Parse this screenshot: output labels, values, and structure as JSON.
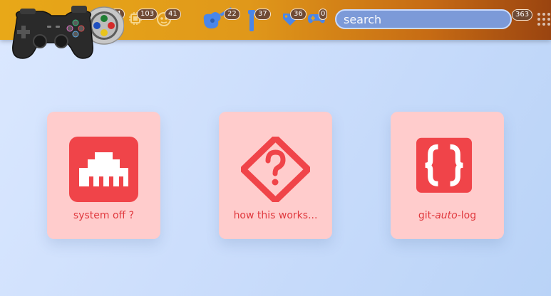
{
  "header": {
    "nav": [
      {
        "name": "nav-retro",
        "count": "64"
      },
      {
        "name": "nav-hardware",
        "count": "103"
      },
      {
        "name": "nav-lab",
        "count": "41"
      },
      {
        "name": "nav-guitar",
        "count": "22"
      },
      {
        "name": "nav-tools",
        "count": "37"
      },
      {
        "name": "nav-tags",
        "count": "36"
      },
      {
        "name": "nav-games",
        "count": "0"
      }
    ],
    "search": {
      "placeholder": "search",
      "value": "",
      "count": "363"
    }
  },
  "cards": [
    {
      "name": "system-off",
      "label": "system off ?",
      "icon": "ethernet-port-icon"
    },
    {
      "name": "how-this-works",
      "label": "how this works...",
      "icon": "question-diamond-icon"
    },
    {
      "name": "git-auto-log",
      "label_prefix": "git-",
      "label_em": "auto",
      "label_suffix": "-log",
      "icon": "braces-icon"
    }
  ],
  "colors": {
    "accent": "#f04449",
    "card_bg": "#ffcccc",
    "card_text": "#e0393e",
    "header_start": "#e8a818",
    "header_end": "#9a4410",
    "nav_icon_blue": "#4a86e8"
  }
}
